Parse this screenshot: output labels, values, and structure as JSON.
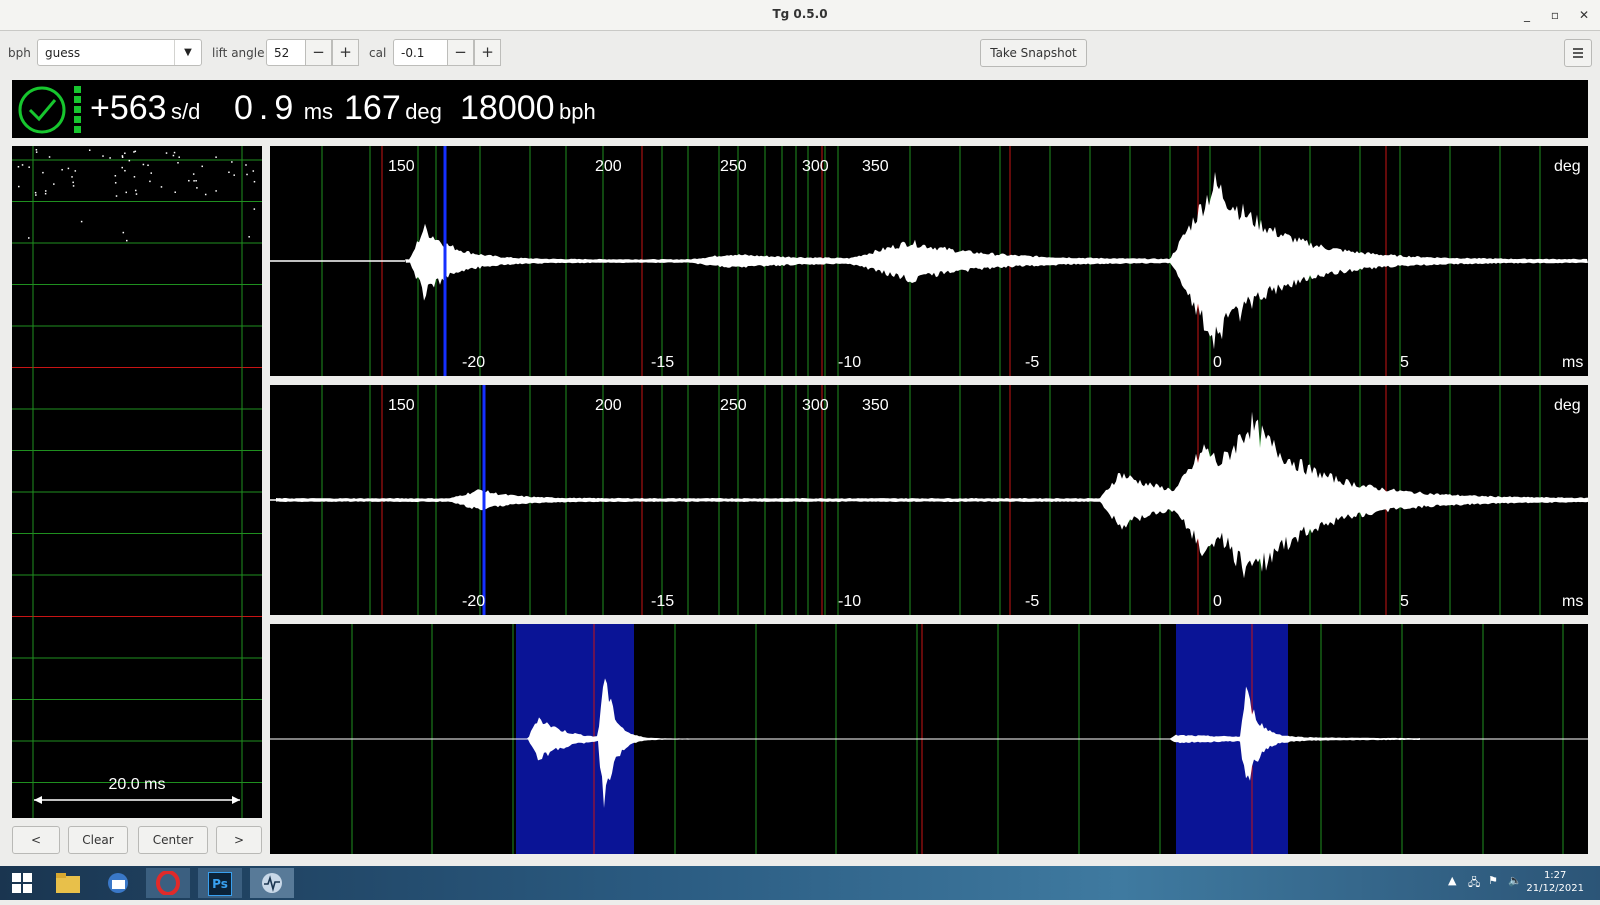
{
  "window": {
    "title": "Tg 0.5.0"
  },
  "toolbar": {
    "bph_label": "bph",
    "bph_value": "guess",
    "lift_angle_label": "lift angle",
    "lift_angle_value": "52",
    "cal_label": "cal",
    "cal_value": "-0.1",
    "minus": "−",
    "plus": "+",
    "snapshot_label": "Take Snapshot",
    "menu_icon": "hamburger-menu-icon"
  },
  "readout": {
    "rate_value": "+563",
    "rate_unit": "s/d",
    "beat_error_value": "0.9",
    "beat_error_unit": "ms",
    "amplitude_value": "167",
    "amplitude_unit": "deg",
    "bph_value": "18000",
    "bph_unit": "bph",
    "status_icon": "clock-check-icon",
    "colors": {
      "ok": "#17c62e",
      "background": "#000000"
    }
  },
  "paperstrip": {
    "scale_label": "20.0 ms",
    "buttons": {
      "left": "<",
      "clear": "Clear",
      "center": "Center",
      "right": ">"
    }
  },
  "scope_top": {
    "deg_ticks": [
      "150",
      "200",
      "250",
      "300",
      "350"
    ],
    "deg_unit": "deg",
    "ms_ticks": [
      "-20",
      "-15",
      "-10",
      "-5",
      "0",
      "5"
    ],
    "ms_unit": "ms"
  },
  "scope_mid": {
    "deg_ticks": [
      "150",
      "200",
      "250",
      "300",
      "350"
    ],
    "deg_unit": "deg",
    "ms_ticks": [
      "-20",
      "-15",
      "-10",
      "-5",
      "0",
      "5"
    ],
    "ms_unit": "ms"
  },
  "taskbar": {
    "icons": [
      "windows-start-icon",
      "file-explorer-icon",
      "thunderbird-icon",
      "opera-icon",
      "photoshop-icon",
      "tg-app-icon"
    ],
    "photoshop_label": "Ps",
    "clock_time": "1:27",
    "clock_date": "21/12/2021"
  }
}
